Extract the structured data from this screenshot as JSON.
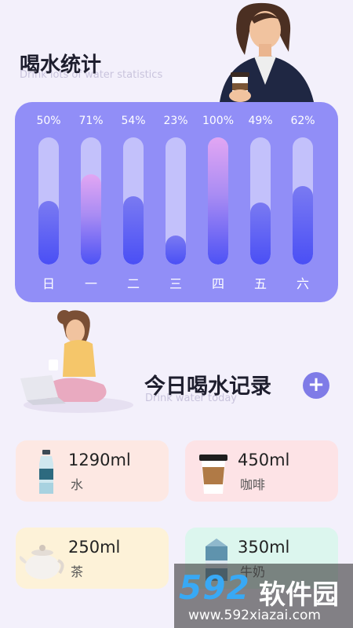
{
  "header": {
    "title": "喝水统计",
    "subtitle": "Drink lots of water statistics"
  },
  "stats": {
    "bars": [
      {
        "day": "日",
        "percent_label": "50%",
        "percent": 50,
        "highlight": false
      },
      {
        "day": "一",
        "percent_label": "71%",
        "percent": 71,
        "highlight": true
      },
      {
        "day": "二",
        "percent_label": "54%",
        "percent": 54,
        "highlight": false
      },
      {
        "day": "三",
        "percent_label": "23%",
        "percent": 23,
        "highlight": false
      },
      {
        "day": "四",
        "percent_label": "100%",
        "percent": 100,
        "highlight": true
      },
      {
        "day": "五",
        "percent_label": "49%",
        "percent": 49,
        "highlight": false
      },
      {
        "day": "六",
        "percent_label": "62%",
        "percent": 62,
        "highlight": false
      }
    ]
  },
  "today": {
    "title": "今日喝水记录",
    "subtitle": "Drink water today",
    "add_icon": "plus-icon"
  },
  "records": [
    {
      "amount": "1290ml",
      "name": "水",
      "icon": "water-bottle-icon"
    },
    {
      "amount": "450ml",
      "name": "咖啡",
      "icon": "coffee-cup-icon"
    },
    {
      "amount": "250ml",
      "name": "茶",
      "icon": "teapot-icon"
    },
    {
      "amount": "350ml",
      "name": "牛奶",
      "icon": "milk-carton-icon"
    }
  ],
  "watermark": {
    "logo": "592",
    "name": "软件园",
    "url": "www.592xiazai.com"
  },
  "colors": {
    "background": "#f3f0fb",
    "card": "#918ef7",
    "bar_track": "#c3c1fb",
    "bar_fill": "#4a4ff5",
    "bar_highlight": "#e2a6f3",
    "add_button": "#7f7be7",
    "water_card": "#fde8e3",
    "coffee_card": "#fde3e6",
    "tea_card": "#fdf2d8",
    "milk_card": "#dcf6ee"
  }
}
